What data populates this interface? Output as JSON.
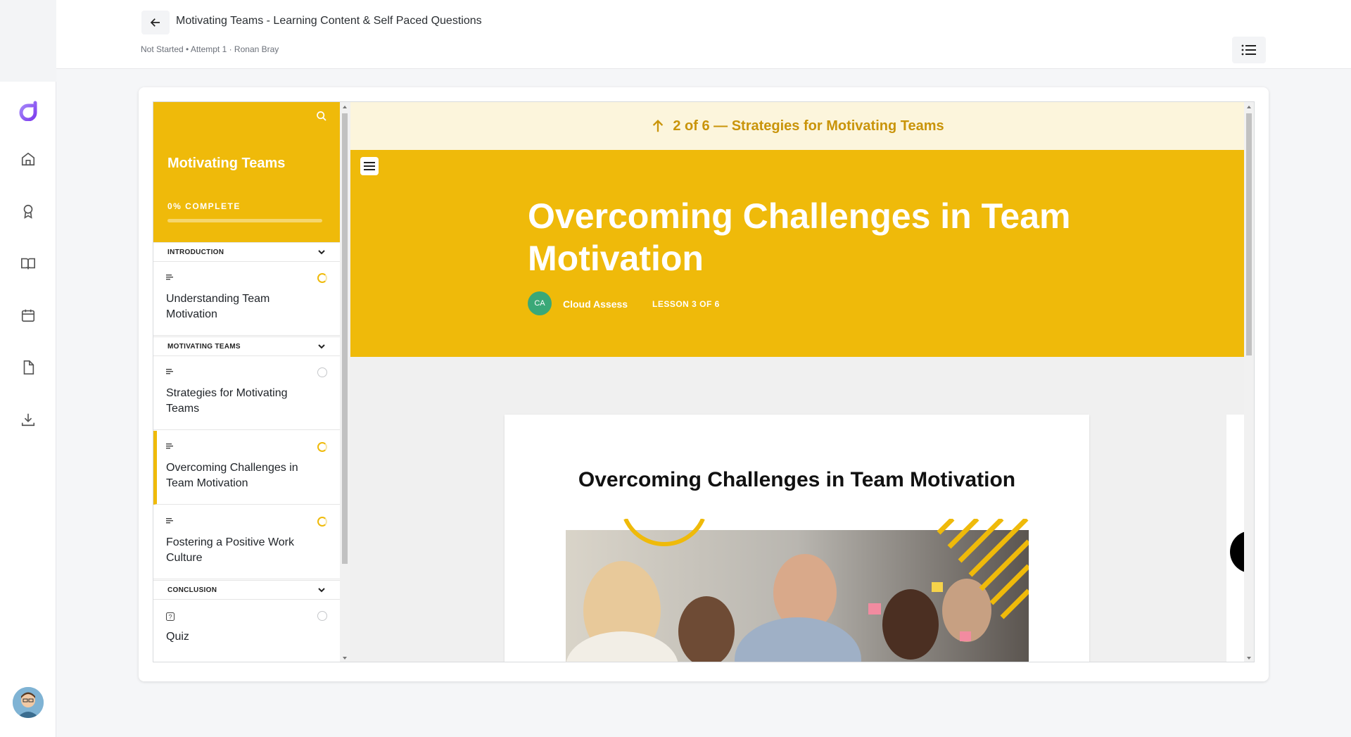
{
  "header": {
    "title": "Motivating Teams - Learning Content & Self Paced Questions",
    "meta": "Not Started • Attempt 1 · Ronan Bray"
  },
  "rail": {
    "icons": [
      "home-icon",
      "award-icon",
      "book-icon",
      "calendar-icon",
      "document-icon",
      "download-icon"
    ]
  },
  "course": {
    "title": "Motivating Teams",
    "progress_label": "0% COMPLETE",
    "progress": 0,
    "sections": [
      {
        "label": "INTRODUCTION"
      },
      {
        "label": "MOTIVATING TEAMS"
      },
      {
        "label": "CONCLUSION"
      }
    ],
    "lessons": [
      {
        "title": "Understanding Team Motivation"
      },
      {
        "title": "Strategies for Motivating Teams"
      },
      {
        "title": "Overcoming Challenges in Team Motivation"
      },
      {
        "title": "Fostering a Positive Work Culture"
      },
      {
        "title": "Quiz"
      }
    ]
  },
  "content": {
    "nav_banner": "2 of 6 — Strategies for Motivating Teams",
    "hero_title": "Overcoming Challenges in Team Motivation",
    "author_initials": "CA",
    "author": "Cloud Assess",
    "lesson_label": "LESSON 3 OF 6",
    "slide_title": "Overcoming Challenges in Team Motivation"
  },
  "colors": {
    "accent": "#efba0a",
    "banner_bg": "#fcf5dc",
    "banner_text": "#c9940a",
    "brand": "#8b5cf6"
  }
}
